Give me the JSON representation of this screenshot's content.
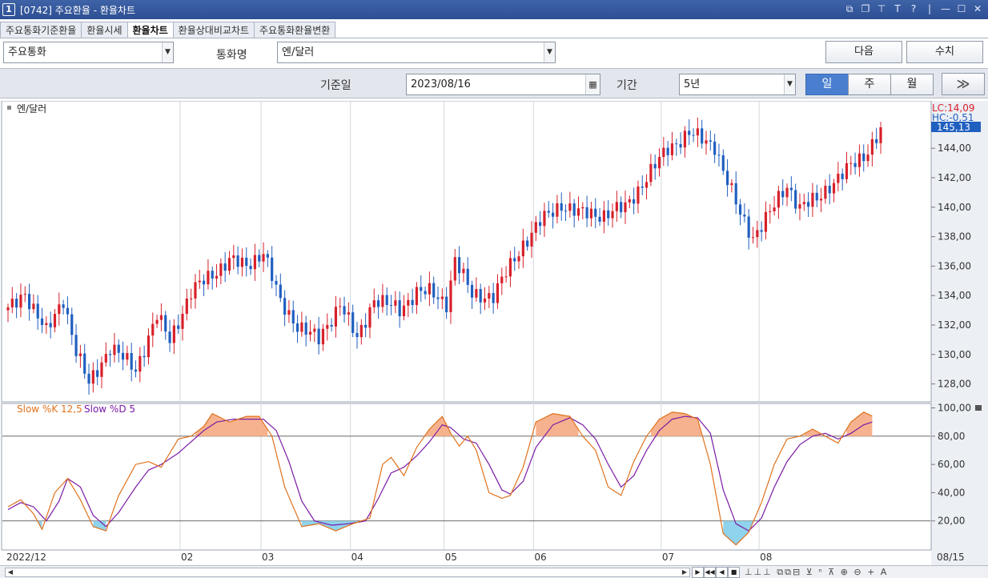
{
  "window": {
    "number": "1",
    "title": "[0742] 주요환율 - 환율차트",
    "icons": [
      "restore-icon",
      "copy-icon",
      "pin-icon",
      "text-icon",
      "help-icon",
      "minimize-icon",
      "maximize-icon",
      "close-icon"
    ]
  },
  "tabs": [
    {
      "label": "주요통화기준환율",
      "active": false
    },
    {
      "label": "환율시세",
      "active": false
    },
    {
      "label": "환율차트",
      "active": true
    },
    {
      "label": "환율상대비교차트",
      "active": false
    },
    {
      "label": "주요통화환율변환",
      "active": false
    }
  ],
  "controls": {
    "currency_group": "주요통화",
    "currency_label": "통화명",
    "currency": "엔/달러",
    "next_button": "다음",
    "value_button": "수치",
    "base_date_label": "기준일",
    "base_date": "2023/08/16",
    "period_label": "기간",
    "period": "5년",
    "interval": [
      "일",
      "주",
      "월"
    ],
    "forward": "≫"
  },
  "chart_data": [
    {
      "type": "candlestick",
      "title": "엔/달러",
      "x_labels": [
        "2022/12",
        "02",
        "03",
        "04",
        "05",
        "06",
        "07",
        "08"
      ],
      "x_end_label": "08/15",
      "y_ticks": [
        "128,00",
        "130,00",
        "132,00",
        "134,00",
        "136,00",
        "138,00",
        "140,00",
        "142,00",
        "144,00"
      ],
      "ylim": [
        127,
        147
      ],
      "annotations": {
        "lc": "LC:14,09",
        "hc": "HC:-0,51",
        "last": "145,13"
      },
      "up_color": "#d8202a",
      "down_color": "#1f5fbf",
      "waypoints": [
        [
          0,
          133.0
        ],
        [
          4,
          134.2
        ],
        [
          9,
          131.5
        ],
        [
          13,
          133.8
        ],
        [
          16,
          130.2
        ],
        [
          19,
          128.0
        ],
        [
          24,
          130.5
        ],
        [
          30,
          129.0
        ],
        [
          35,
          132.6
        ],
        [
          38,
          131.0
        ],
        [
          43,
          134.2
        ],
        [
          46,
          135.0
        ],
        [
          52,
          136.4
        ],
        [
          56,
          136.0
        ],
        [
          60,
          137.0
        ],
        [
          64,
          133.5
        ],
        [
          68,
          132.0
        ],
        [
          73,
          131.0
        ],
        [
          78,
          133.5
        ],
        [
          82,
          131.0
        ],
        [
          86,
          133.8
        ],
        [
          92,
          133.0
        ],
        [
          96,
          134.3
        ],
        [
          99,
          134.2
        ],
        [
          103,
          133.5
        ],
        [
          105,
          136.5
        ],
        [
          109,
          134.0
        ],
        [
          114,
          134.0
        ],
        [
          117,
          135.5
        ],
        [
          121,
          137.5
        ],
        [
          125,
          139.0
        ],
        [
          130,
          140.2
        ],
        [
          134,
          139.6
        ],
        [
          140,
          139.5
        ],
        [
          145,
          140.0
        ],
        [
          150,
          142.0
        ],
        [
          155,
          144.0
        ],
        [
          160,
          145.0
        ],
        [
          166,
          144.2
        ],
        [
          168,
          142.5
        ],
        [
          172,
          139.5
        ],
        [
          175,
          138.0
        ],
        [
          179,
          139.6
        ],
        [
          183,
          141.5
        ],
        [
          186,
          140.0
        ],
        [
          190,
          140.5
        ],
        [
          193,
          141.5
        ],
        [
          197,
          142.5
        ],
        [
          201,
          143.5
        ],
        [
          205,
          145.2
        ]
      ]
    },
    {
      "type": "line",
      "title": "Slow %K 12,5  Slow %D 5",
      "series": [
        {
          "name": "Slow %K 12,5",
          "color": "#e0721c"
        },
        {
          "name": "Slow %D 5",
          "color": "#7b1aa5"
        }
      ],
      "y_ticks": [
        "20,00",
        "40,00",
        "60,00",
        "80,00",
        "100,00"
      ],
      "ylim": [
        0,
        102
      ],
      "bands": [
        20,
        80
      ],
      "waypoints_k": [
        [
          0,
          30
        ],
        [
          3,
          35
        ],
        [
          6,
          25
        ],
        [
          8,
          14
        ],
        [
          11,
          40
        ],
        [
          14,
          50
        ],
        [
          17,
          35
        ],
        [
          20,
          16
        ],
        [
          23,
          13
        ],
        [
          26,
          38
        ],
        [
          30,
          60
        ],
        [
          33,
          62
        ],
        [
          36,
          58
        ],
        [
          40,
          78
        ],
        [
          43,
          80
        ],
        [
          46,
          87
        ],
        [
          48,
          96
        ],
        [
          52,
          90
        ],
        [
          56,
          94
        ],
        [
          59,
          94
        ],
        [
          62,
          80
        ],
        [
          65,
          44
        ],
        [
          69,
          16
        ],
        [
          73,
          18
        ],
        [
          77,
          13
        ],
        [
          81,
          18
        ],
        [
          85,
          22
        ],
        [
          88,
          60
        ],
        [
          90,
          65
        ],
        [
          93,
          52
        ],
        [
          96,
          72
        ],
        [
          99,
          85
        ],
        [
          102,
          94
        ],
        [
          104,
          82
        ],
        [
          106,
          73
        ],
        [
          108,
          80
        ],
        [
          110,
          70
        ],
        [
          113,
          40
        ],
        [
          116,
          36
        ],
        [
          118,
          38
        ],
        [
          121,
          58
        ],
        [
          124,
          90
        ],
        [
          128,
          96
        ],
        [
          132,
          94
        ],
        [
          135,
          80
        ],
        [
          138,
          70
        ],
        [
          141,
          44
        ],
        [
          144,
          38
        ],
        [
          147,
          62
        ],
        [
          150,
          80
        ],
        [
          153,
          92
        ],
        [
          156,
          97
        ],
        [
          159,
          96
        ],
        [
          162,
          92
        ],
        [
          165,
          60
        ],
        [
          168,
          11
        ],
        [
          171,
          3
        ],
        [
          174,
          12
        ],
        [
          177,
          33
        ],
        [
          180,
          60
        ],
        [
          183,
          78
        ],
        [
          186,
          80
        ],
        [
          189,
          85
        ],
        [
          192,
          80
        ],
        [
          195,
          75
        ],
        [
          198,
          90
        ],
        [
          201,
          97
        ],
        [
          204,
          93
        ]
      ],
      "waypoints_d": [
        [
          0,
          28
        ],
        [
          3,
          33
        ],
        [
          6,
          30
        ],
        [
          9,
          20
        ],
        [
          12,
          34
        ],
        [
          14,
          50
        ],
        [
          17,
          44
        ],
        [
          20,
          24
        ],
        [
          23,
          16
        ],
        [
          26,
          26
        ],
        [
          30,
          44
        ],
        [
          33,
          56
        ],
        [
          36,
          60
        ],
        [
          40,
          68
        ],
        [
          43,
          76
        ],
        [
          46,
          84
        ],
        [
          49,
          90
        ],
        [
          53,
          92
        ],
        [
          57,
          92
        ],
        [
          60,
          92
        ],
        [
          63,
          84
        ],
        [
          66,
          62
        ],
        [
          69,
          34
        ],
        [
          72,
          20
        ],
        [
          76,
          17
        ],
        [
          80,
          18
        ],
        [
          84,
          20
        ],
        [
          87,
          36
        ],
        [
          90,
          54
        ],
        [
          93,
          58
        ],
        [
          96,
          66
        ],
        [
          99,
          76
        ],
        [
          102,
          88
        ],
        [
          104,
          86
        ],
        [
          107,
          78
        ],
        [
          110,
          75
        ],
        [
          113,
          60
        ],
        [
          116,
          42
        ],
        [
          118,
          39
        ],
        [
          121,
          48
        ],
        [
          124,
          72
        ],
        [
          128,
          88
        ],
        [
          132,
          93
        ],
        [
          135,
          88
        ],
        [
          138,
          78
        ],
        [
          141,
          60
        ],
        [
          144,
          44
        ],
        [
          147,
          52
        ],
        [
          150,
          70
        ],
        [
          153,
          84
        ],
        [
          156,
          92
        ],
        [
          159,
          94
        ],
        [
          162,
          93
        ],
        [
          165,
          82
        ],
        [
          168,
          42
        ],
        [
          171,
          18
        ],
        [
          174,
          13
        ],
        [
          177,
          22
        ],
        [
          180,
          44
        ],
        [
          183,
          62
        ],
        [
          186,
          74
        ],
        [
          189,
          80
        ],
        [
          192,
          82
        ],
        [
          195,
          78
        ],
        [
          198,
          82
        ],
        [
          201,
          88
        ],
        [
          204,
          91
        ]
      ]
    }
  ],
  "nav": {
    "buttons": [
      "▶",
      "◀◀",
      "◀",
      "■",
      "▶▶"
    ],
    "tools": "⊥⊥⊥  ⧉⧉⊟  ⊻ ⁿ ⊼  ⊕ ⊖ + A"
  }
}
